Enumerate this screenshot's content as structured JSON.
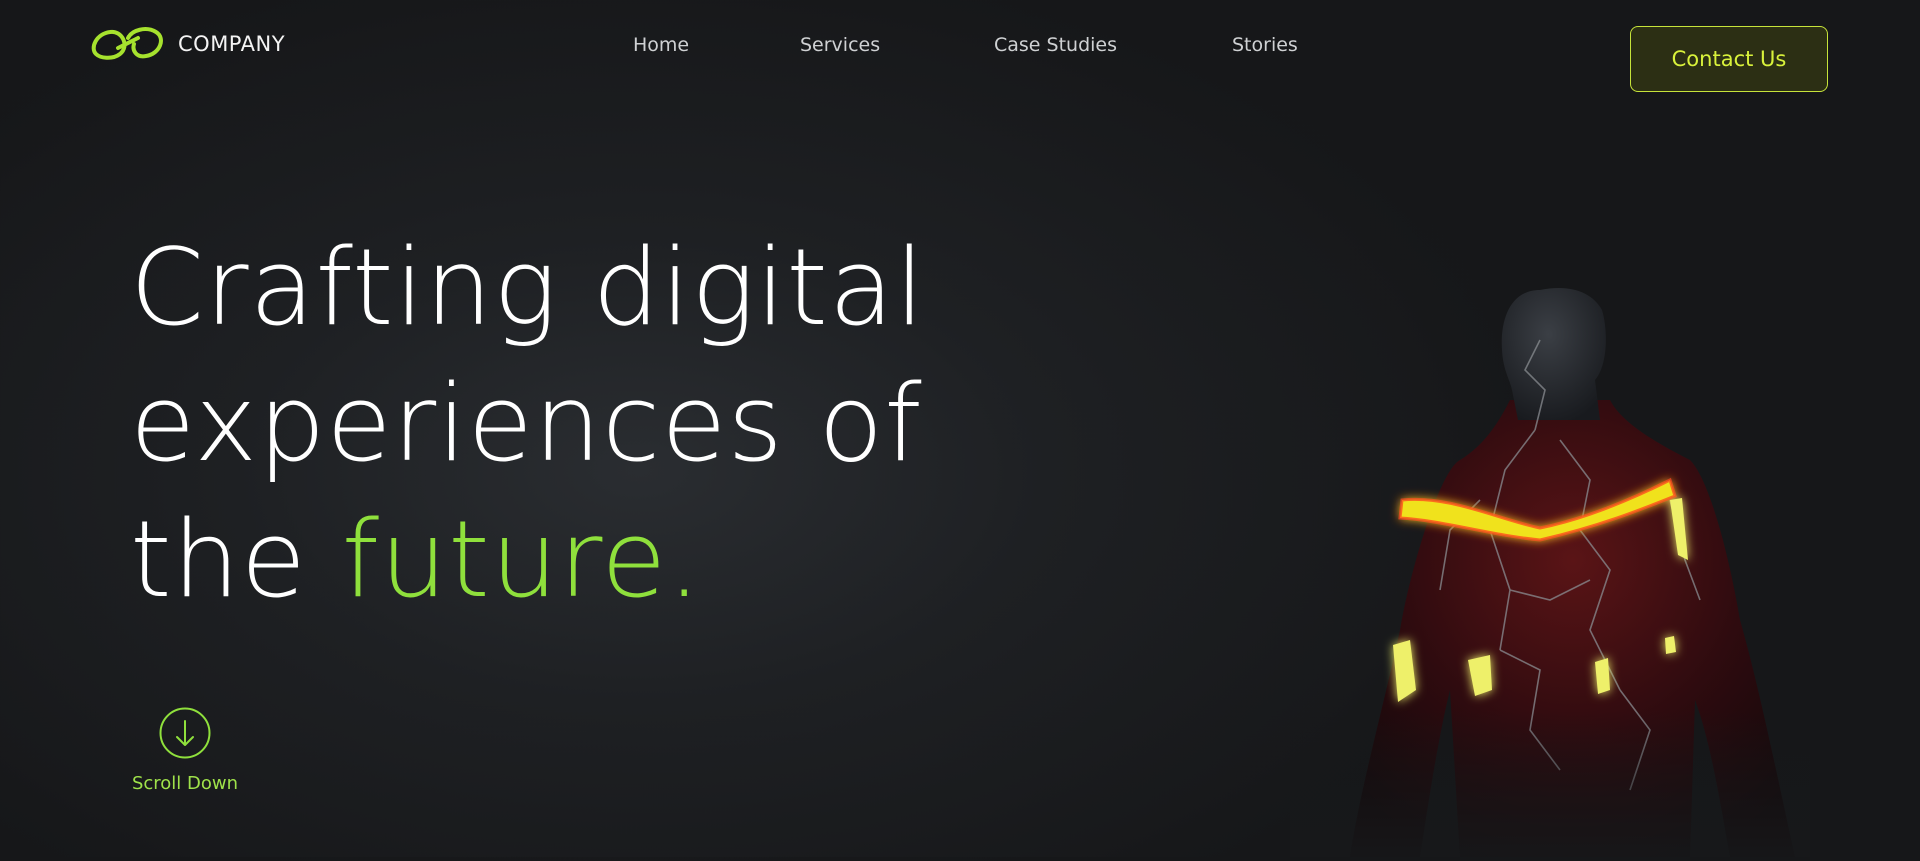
{
  "brand": {
    "name": "COMPANY",
    "logo_icon": "infinity-link-logo-icon",
    "accent_color": "#8fe03c"
  },
  "nav": {
    "items": [
      {
        "label": "Home"
      },
      {
        "label": "Services"
      },
      {
        "label": "Case Studies"
      },
      {
        "label": "Stories"
      }
    ]
  },
  "header": {
    "cta_label": "Contact Us",
    "cta_color": "#d9f23b"
  },
  "hero": {
    "line1": "Crafting digital",
    "line2": "experiences of",
    "line3_prefix": "the ",
    "line3_accent": "future."
  },
  "scroll": {
    "label": "Scroll Down",
    "icon": "arrow-down-circle-icon"
  },
  "visual": {
    "figure": "glowing-humanoid-figure"
  }
}
